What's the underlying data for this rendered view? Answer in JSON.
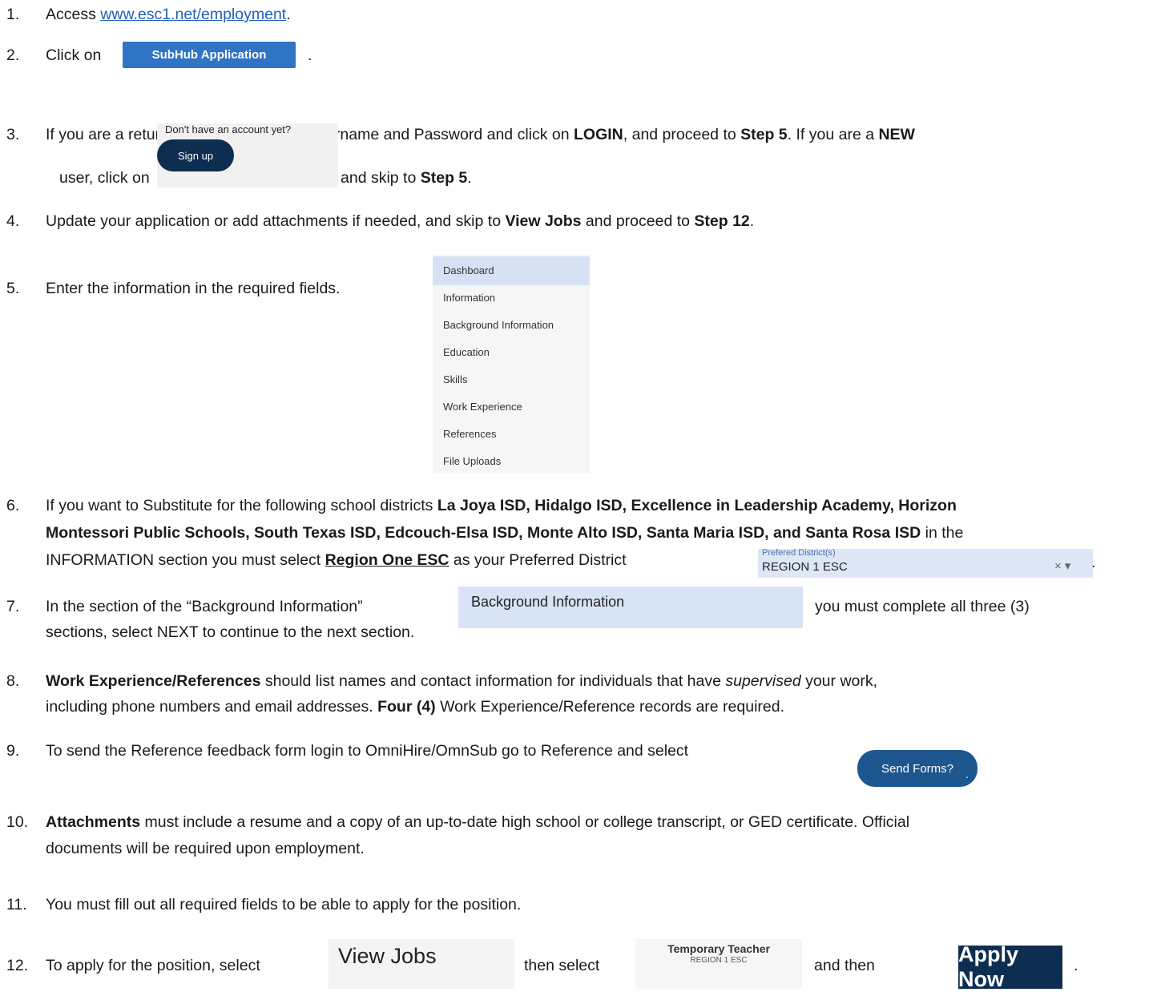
{
  "steps": {
    "s1": {
      "num": "1.",
      "pre": "Access ",
      "link": "www.esc1.net/employment",
      "post": "."
    },
    "s2": {
      "num": "2.",
      "pre": "Click on",
      "button": "SubHub Application",
      "post": "."
    },
    "s3": {
      "num": "3.",
      "line1_a": "If you are a returning user, enter your Username and Password and click on ",
      "login": "LOGIN",
      "line1_b": ", and proceed to ",
      "step5a": "Step 5",
      "line1_c": ". If you are a ",
      "new": "NEW",
      "line2_a": "user, click on",
      "signup_prompt": "Don't have an account yet?",
      "signup_button": "Sign up",
      "line2_b": "and skip to ",
      "step5b": "Step 5",
      "line2_c": "."
    },
    "s4": {
      "num": "4.",
      "a": "Update your application or add attachments if needed, and skip to ",
      "viewjobs": "View Jobs",
      "b": " and proceed to ",
      "step12": "Step 12",
      "c": "."
    },
    "s5": {
      "num": "5.",
      "text": "Enter the information in the required fields.",
      "menu": [
        "Dashboard",
        "Information",
        "Background Information",
        "Education",
        "Skills",
        "Work Experience",
        "References",
        "File Uploads"
      ]
    },
    "s6": {
      "num": "6.",
      "a": "If you want to Substitute for the following school districts ",
      "districts1": "La Joya ISD, Hidalgo ISD, Excellence in Leadership Academy, Horizon",
      "districts2": "Montessori Public Schools, South Texas ISD, Edcouch-Elsa ISD, Monte Alto ISD, Santa Maria ISD, and Santa Rosa ISD",
      "b": " in the",
      "c": "INFORMATION section you must select ",
      "region": "Region One ESC",
      "d": " as your Preferred District",
      "field_label": "Prefered District(s)",
      "field_value": "REGION 1 ESC",
      "field_ctrl": "× ▾",
      "e": "."
    },
    "s7": {
      "num": "7.",
      "a": "In the section of the “Background Information”",
      "box": "Background Information",
      "b": "you must complete all three (3)",
      "c": "sections, select NEXT to continue to the next section."
    },
    "s8": {
      "num": "8.",
      "bold": "Work Experience/References",
      "a": " should list names and contact information for individuals that have ",
      "ital": "supervised",
      "b": " your work,",
      "c": "including phone numbers and email addresses. ",
      "four": "Four (4)",
      "d": " Work Experience/Reference records are required."
    },
    "s9": {
      "num": "9.",
      "text": "To send the Reference feedback form login to OmniHire/OmnSub go to Reference and select",
      "button": "Send Forms?",
      "post": "."
    },
    "s10": {
      "num": "10.",
      "bold": "Attachments",
      "a": " must include a resume and a copy of an up-to-date high school or college transcript, or GED certificate. Official",
      "b": "documents will be required upon employment."
    },
    "s11": {
      "num": "11.",
      "text": "You must fill out all required fields to be able to apply for the position."
    },
    "s12": {
      "num": "12.",
      "a": "To apply for the position, select",
      "viewjobs": "View Jobs",
      "b": "then select",
      "job_title": "Temporary Teacher",
      "job_sub": "REGION 1 ESC",
      "c": "and then",
      "apply": "Apply Now",
      "d": "."
    }
  }
}
